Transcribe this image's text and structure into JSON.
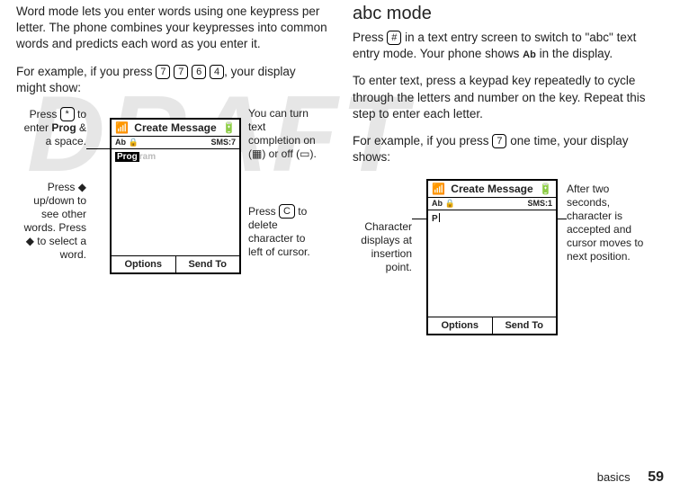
{
  "left": {
    "p1": "Word mode lets you enter words using one keypress per letter. The phone combines your keypresses into common words and predicts each word as you enter it.",
    "p2_a": "For example, if you press ",
    "p2_keys": [
      "7",
      "7",
      "6",
      "4"
    ],
    "p2_b": ", your display might show:",
    "fig": {
      "cap1_a": "Press ",
      "cap1_key": "*",
      "cap1_b": " to enter ",
      "cap1_bold": "Prog",
      "cap1_c": " & a space.",
      "cap2_a": "Press ",
      "cap2_b": " up/down to see other words. Press ",
      "cap2_c": " to select a word.",
      "cap3_a": "You can turn text completion on (",
      "cap3_b": ") or off (",
      "cap3_c": ").",
      "cap4_a": "Press ",
      "cap4_key": "C",
      "cap4_b": " to delete character to left of cursor.",
      "phone": {
        "title": "Create Message",
        "status_left": "Ab 🔒",
        "status_right": "SMS:7",
        "body_highlight": "Prog",
        "body_shadow": "ram",
        "soft_left": "Options",
        "soft_right": "Send To"
      }
    }
  },
  "right": {
    "h2": "abc mode",
    "p1_a": "Press ",
    "p1_key": "#",
    "p1_b": " in a text entry screen to switch to \"abc\" text entry mode. Your phone shows ",
    "p1_ab": "Ab",
    "p1_c": " in the display.",
    "p2": "To enter text, press a keypad key repeatedly to cycle through the letters and number on the key. Repeat this step to enter each letter.",
    "p3_a": "For example, if you press ",
    "p3_key": "7",
    "p3_b": " one time, your display shows:",
    "fig": {
      "cap_left": "Character displays at insertion point.",
      "cap_right": "After two seconds, character is accepted and cursor moves to next position.",
      "phone": {
        "title": "Create Message",
        "status_left": "Ab 🔒",
        "status_right": "SMS:1",
        "body_char": "P",
        "soft_left": "Options",
        "soft_right": "Send To"
      }
    }
  },
  "footer": {
    "section": "basics",
    "page": "59"
  }
}
